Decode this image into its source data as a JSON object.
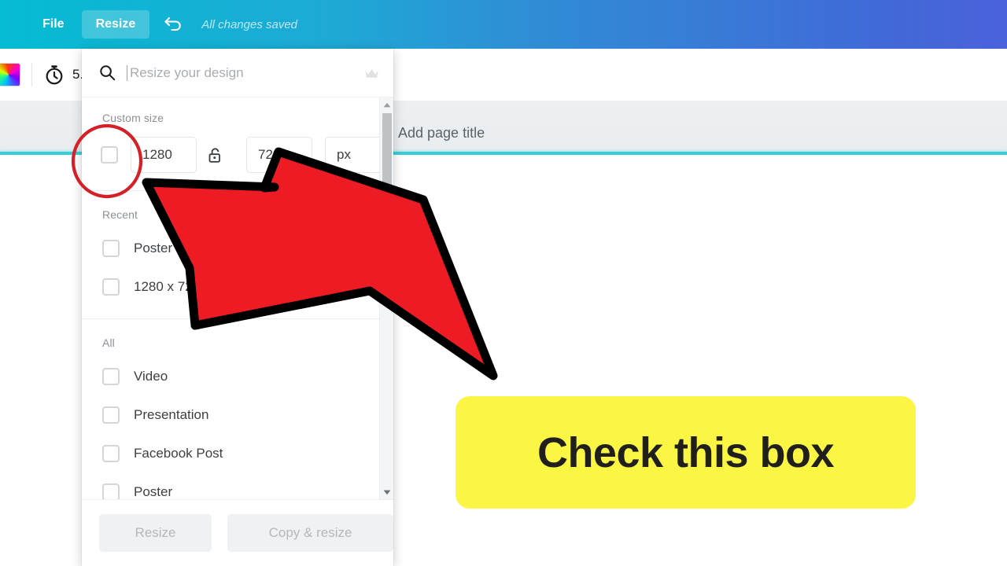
{
  "header": {
    "file_label": "File",
    "resize_label": "Resize",
    "undo_icon": "undo-arrow-icon",
    "status_text": "All changes saved",
    "gradient_from": "#05bcd2",
    "gradient_to": "#4a62da"
  },
  "toolbar": {
    "color_swatch_name": "rainbow-color-swatch",
    "timer_icon": "stopwatch-icon",
    "timer_label": "5."
  },
  "workspace": {
    "page_title_placeholder": "Add page title",
    "accent_rule_color": "#36cfd8",
    "background_color": "#eaeef0"
  },
  "panel": {
    "search": {
      "placeholder": "Resize your design",
      "value": "",
      "search_icon": "search-icon",
      "crown_icon": "crown-icon"
    },
    "custom_size": {
      "section_label": "Custom size",
      "checkbox_checked": false,
      "width_value": "1280",
      "height_value": "720",
      "lock_icon": "unlocked-padlock-icon",
      "unit_value": "px",
      "unit_chevron": "chevron-down-icon"
    },
    "recent": {
      "section_label": "Recent",
      "items": [
        {
          "label": "Poster",
          "checked": false
        },
        {
          "label": "1280 x 720 px",
          "checked": false
        }
      ]
    },
    "all": {
      "section_label": "All",
      "items": [
        {
          "label": "Video",
          "checked": false
        },
        {
          "label": "Presentation",
          "checked": false
        },
        {
          "label": "Facebook Post",
          "checked": false
        },
        {
          "label": "Poster",
          "checked": false
        }
      ]
    },
    "scrollbar": {
      "up_arrow_icon": "scroll-up-arrow-icon",
      "down_arrow_icon": "scroll-down-arrow-icon"
    },
    "footer": {
      "resize_label": "Resize",
      "copy_resize_label": "Copy & resize"
    }
  },
  "annotations": {
    "callout_text": "Check this box",
    "callout_bg": "#faf643",
    "callout_text_color": "#211f1c",
    "arrow_fill": "#ed1c24",
    "arrow_stroke": "#000000",
    "circle_stroke": "#d42026"
  }
}
